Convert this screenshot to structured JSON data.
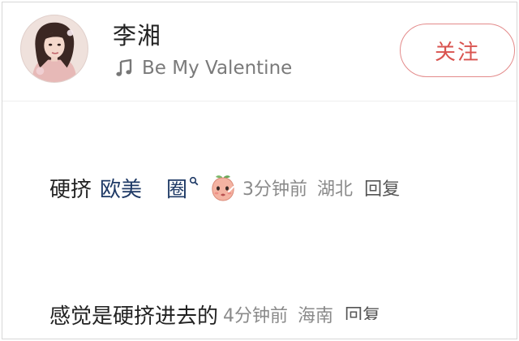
{
  "profile": {
    "name": "李湘",
    "song": "Be My Valentine",
    "follow_label": "关注"
  },
  "comments": [
    {
      "text": "硬挤",
      "link_words": [
        "欧美",
        "圈"
      ],
      "time": "3分钟前",
      "location": "湖北",
      "reply_label": "回复"
    },
    {
      "text": "感觉是硬挤进去的",
      "time": "4分钟前",
      "location": "海南",
      "reply_label": "回复"
    }
  ],
  "colors": {
    "accent": "#d9534f",
    "link": "#1f3a66",
    "meta": "#8a8a8a"
  },
  "icons": {
    "music": "music-note-icon",
    "search": "search-icon",
    "emoji": "peach-emoji-icon"
  }
}
